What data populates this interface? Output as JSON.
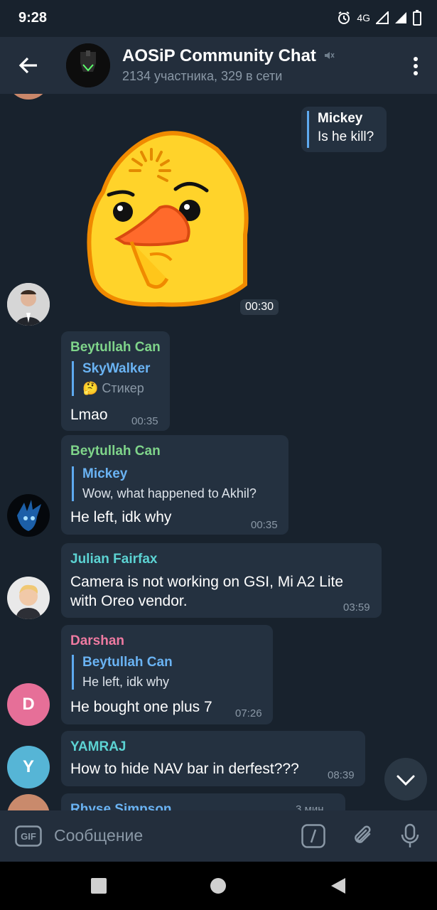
{
  "status": {
    "time": "9:28",
    "network": "4G"
  },
  "header": {
    "title": "AOSiP Community Chat",
    "subtitle": "2134 участника, 329 в сети"
  },
  "messages": [
    {
      "id": "m1",
      "quote_name": "Mickey",
      "quote_text": "Is he kill?"
    },
    {
      "id": "m2",
      "kind": "sticker",
      "time": "00:30"
    },
    {
      "id": "m3",
      "sender": "Beytullah Can",
      "quote_name": "SkyWalker",
      "quote_text": "🤔 Стикер",
      "text": "Lmao",
      "time": "00:35"
    },
    {
      "id": "m4",
      "sender": "Beytullah Can",
      "quote_name": "Mickey",
      "quote_text": "Wow, what happened to Akhil?",
      "text": "He left, idk why",
      "time": "00:35"
    },
    {
      "id": "m5",
      "sender": "Julian Fairfax",
      "text_line1": "Camera is not working on GSI, Mi A2 Lite",
      "text_line2": "with Oreo vendor.",
      "time": "03:59"
    },
    {
      "id": "m6",
      "sender": "Darshan",
      "avatar_letter": "D",
      "quote_name": "Beytullah Can",
      "quote_text": "He left, idk why",
      "text": "He bought one plus 7",
      "time": "07:26"
    },
    {
      "id": "m7",
      "sender": "YAMRAJ",
      "avatar_letter": "Y",
      "text": "How to hide NAV bar in derfest???",
      "time": "08:39"
    },
    {
      "id": "m8",
      "sender": "Rhyse Simpson",
      "time": "3 мин"
    }
  ],
  "composer": {
    "placeholder": "Сообщение"
  },
  "colors": {
    "bg": "#18222d",
    "header": "#232e3c",
    "bubble": "#243140",
    "link": "#6ab3f3",
    "green_name": "#7fd48a",
    "cyan_name": "#5cd3d3",
    "pink_name": "#ee7aa1",
    "avatar_pink": "#e66f98",
    "avatar_blue": "#56b5d6",
    "sticker_yellow": "#ffd32a"
  }
}
